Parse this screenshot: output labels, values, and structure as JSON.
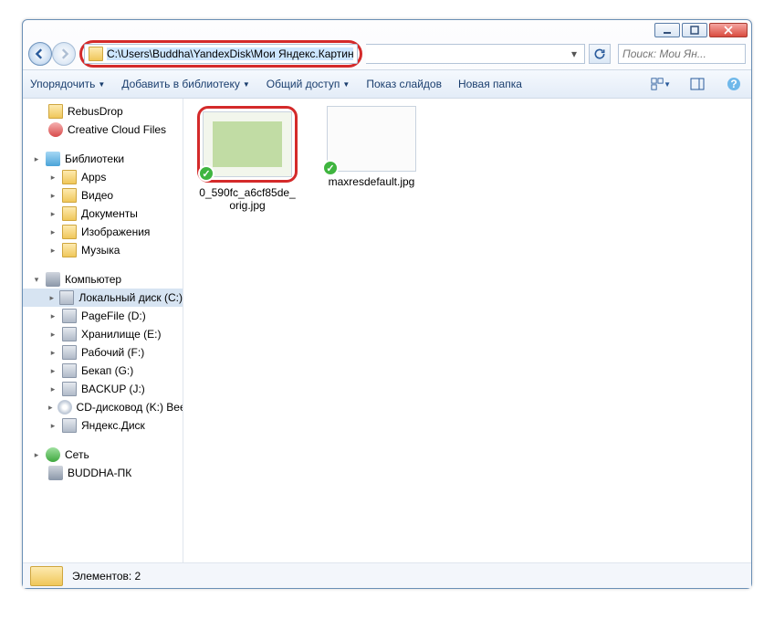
{
  "address": {
    "path": "C:\\Users\\Buddha\\YandexDisk\\Мои Яндекс.Картинки"
  },
  "search": {
    "placeholder": "Поиск: Мои Ян..."
  },
  "toolbar": {
    "organize": "Упорядочить",
    "addToLibrary": "Добавить в библиотеку",
    "share": "Общий доступ",
    "slideshow": "Показ слайдов",
    "newFolder": "Новая папка"
  },
  "sidebar": {
    "favorites": [
      {
        "label": "RebusDrop"
      },
      {
        "label": "Creative Cloud Files"
      }
    ],
    "librariesHeader": "Библиотеки",
    "libraries": [
      {
        "label": "Apps"
      },
      {
        "label": "Видео"
      },
      {
        "label": "Документы"
      },
      {
        "label": "Изображения"
      },
      {
        "label": "Музыка"
      }
    ],
    "computerHeader": "Компьютер",
    "drives": [
      {
        "label": "Локальный диск (C:)",
        "selected": true
      },
      {
        "label": "PageFile (D:)"
      },
      {
        "label": "Хранилище (E:)"
      },
      {
        "label": "Рабочий (F:)"
      },
      {
        "label": "Бекап (G:)"
      },
      {
        "label": "BACKUP (J:)"
      },
      {
        "label": "CD-дисковод (K:) Bee"
      },
      {
        "label": "Яндекс.Диск"
      }
    ],
    "networkHeader": "Сеть",
    "network": [
      {
        "label": "BUDDHA-ПК"
      }
    ]
  },
  "files": [
    {
      "name": "0_590fc_a6cf85de_orig.jpg",
      "highlighted": true,
      "style": "green"
    },
    {
      "name": "maxresdefault.jpg",
      "highlighted": false,
      "style": "white"
    }
  ],
  "status": {
    "text": "Элементов: 2"
  }
}
